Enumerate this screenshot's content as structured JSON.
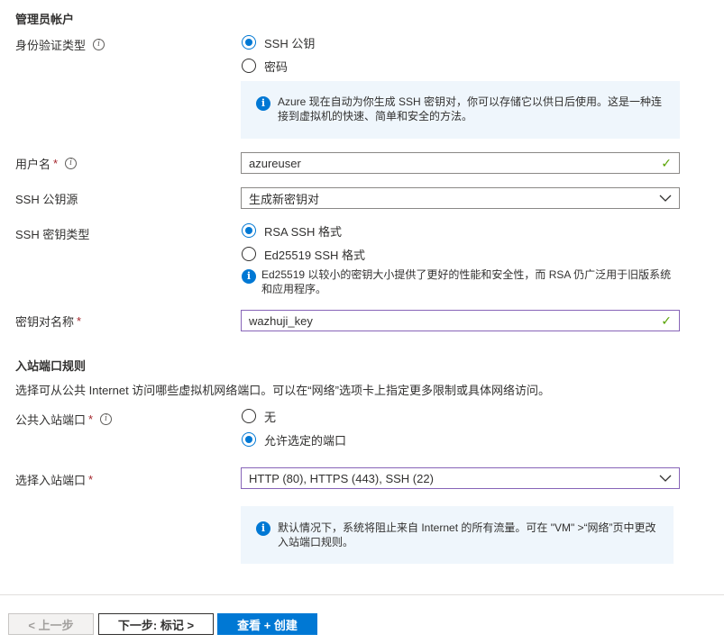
{
  "admin": {
    "heading": "管理员帐户",
    "auth_type": {
      "label": "身份验证类型",
      "options": [
        "SSH 公钥",
        "密码"
      ],
      "selected": 0
    },
    "auth_info": "Azure 现在自动为你生成 SSH 密钥对，你可以存储它以供日后使用。这是一种连接到虚拟机的快速、简单和安全的方法。",
    "username": {
      "label": "用户名",
      "required": "*",
      "value": "azureuser"
    },
    "ssh_source": {
      "label": "SSH 公钥源",
      "value": "生成新密钥对"
    },
    "ssh_key_type": {
      "label": "SSH 密钥类型",
      "options": [
        "RSA SSH 格式",
        "Ed25519 SSH 格式"
      ],
      "selected": 0,
      "info": "Ed25519 以较小的密钥大小提供了更好的性能和安全性，而 RSA 仍广泛用于旧版系统和应用程序。"
    },
    "key_pair_name": {
      "label": "密钥对名称",
      "required": "*",
      "value": "wazhuji_key"
    }
  },
  "inbound": {
    "heading": "入站端口规则",
    "description": "选择可从公共 Internet 访问哪些虚拟机网络端口。可以在“网络”选项卡上指定更多限制或具体网络访问。",
    "public_ports": {
      "label": "公共入站端口",
      "required": "*",
      "options": [
        "无",
        "允许选定的端口"
      ],
      "selected": 1
    },
    "select_ports": {
      "label": "选择入站端口",
      "required": "*",
      "value": "HTTP (80), HTTPS (443), SSH (22)"
    },
    "info": "默认情况下，系统将阻止来自 Internet 的所有流量。可在 \"VM\" >“网络”页中更改入站端口规则。"
  },
  "footer": {
    "prev": "< 上一步",
    "next": "下一步: 标记 >",
    "review": "查看 + 创建"
  },
  "colors": {
    "accent": "#0078d4",
    "valid": "#57a300",
    "required": "#a4262c",
    "focus": "#8764b8"
  }
}
